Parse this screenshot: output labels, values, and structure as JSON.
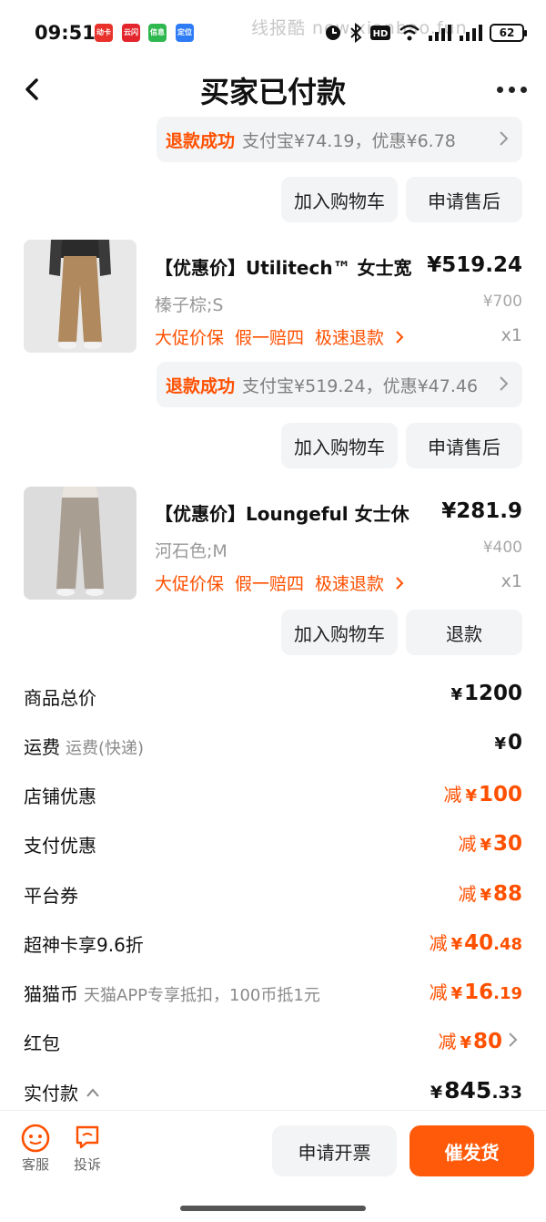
{
  "status_bar": {
    "time": "09:51",
    "watermark": "线报酷 new.xianbao.fun",
    "battery": "62",
    "apps": [
      "动卡",
      "云闪付",
      "信息",
      "定位"
    ]
  },
  "header": {
    "title": "买家已付款"
  },
  "items": [
    {
      "refund": {
        "status": "退款成功",
        "detail": "支付宝¥74.19，优惠¥6.78"
      },
      "actions": [
        "加入购物车",
        "申请售后"
      ]
    },
    {
      "title": "【优惠价】Utilitech™ 女士宽",
      "price": "¥519.24",
      "sku": "榛子棕;S",
      "orig_price": "¥700",
      "tags": [
        "大促价保",
        "假一赔四",
        "极速退款"
      ],
      "qty": "x1",
      "refund": {
        "status": "退款成功",
        "detail": "支付宝¥519.24，优惠¥47.46"
      },
      "actions": [
        "加入购物车",
        "申请售后"
      ],
      "pants_color": "#b08a5e"
    },
    {
      "title": "【优惠价】Loungeful 女士休",
      "price": "¥281.9",
      "sku": "河石色;M",
      "orig_price": "¥400",
      "tags": [
        "大促价保",
        "假一赔四",
        "极速退款"
      ],
      "qty": "x1",
      "actions": [
        "加入购物车",
        "退款"
      ],
      "pants_color": "#a99e92"
    }
  ],
  "summary": {
    "goods_total": {
      "label": "商品总价",
      "value": "1200"
    },
    "shipping": {
      "label": "运费",
      "sub": "运费(快递)",
      "value": "0"
    },
    "store_discount": {
      "label": "店铺优惠",
      "minus": "减",
      "value": "100"
    },
    "pay_discount": {
      "label": "支付优惠",
      "minus": "减",
      "value": "30"
    },
    "platform_coupon": {
      "label": "平台券",
      "minus": "减",
      "value": "88"
    },
    "super_card": {
      "label": "超神卡享9.6折",
      "minus": "减",
      "value": "40",
      "decimal": ".48"
    },
    "cat_coin": {
      "label": "猫猫币",
      "sub": "天猫APP专享抵扣，100币抵1元",
      "minus": "减",
      "value": "16",
      "decimal": ".19"
    },
    "red_packet": {
      "label": "红包",
      "minus": "减",
      "value": "80"
    },
    "paid": {
      "label": "实付款",
      "value": "845",
      "decimal": ".33"
    },
    "yen": "¥"
  },
  "bottom": {
    "service": "客服",
    "complain": "投诉",
    "invoice": "申请开票",
    "urge": "催发货"
  },
  "colors": {
    "accent": "#ff5000",
    "button_bg": "#f3f4f6"
  }
}
